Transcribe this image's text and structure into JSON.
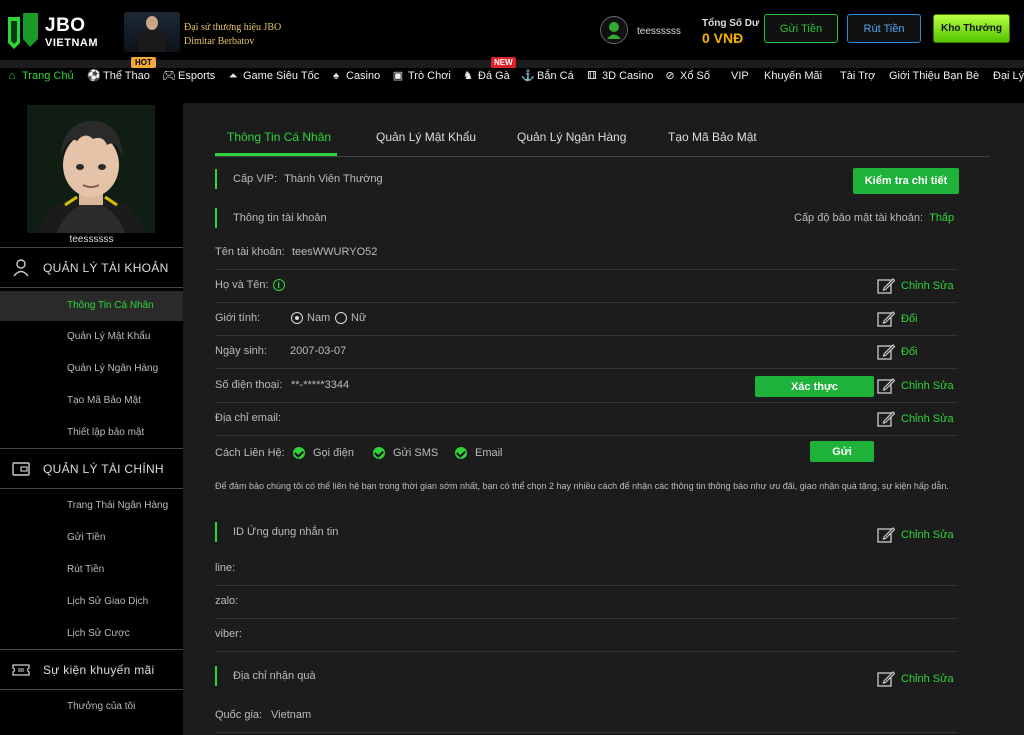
{
  "header": {
    "logo_main": "JBO",
    "logo_sub": "VIETNAM",
    "ambassador_line1": "Đại sứ thương hiệu JBO",
    "ambassador_line2": "Dimitar Berbatov",
    "hot_badge": "HOT",
    "username": "teessssss",
    "balance_label": "Tổng Số Dư",
    "balance_value": "0 VNĐ",
    "deposit_label": "Gửi Tiền",
    "withdraw_label": "Rút Tiền",
    "reward_label": "Kho Thưởng"
  },
  "nav": {
    "new_badge": "NEW",
    "items": [
      {
        "label": "Trang Chủ",
        "icon": "home-icon"
      },
      {
        "label": "Thể Thao",
        "icon": "soccer-ball-icon"
      },
      {
        "label": "Esports",
        "icon": "gamepad-icon"
      },
      {
        "label": "Game Siêu Tốc",
        "icon": "shoe-icon"
      },
      {
        "label": "Casino",
        "icon": "cards-icon"
      },
      {
        "label": "Trò Chơi",
        "icon": "slot-machine-icon"
      },
      {
        "label": "Đá Gà",
        "icon": "rooster-icon"
      },
      {
        "label": "Bắn Cá",
        "icon": "fish-icon"
      },
      {
        "label": "3D Casino",
        "icon": "dice-icon"
      },
      {
        "label": "Xổ Số",
        "icon": "lottery-ball-icon"
      },
      {
        "label": "VIP",
        "icon": ""
      },
      {
        "label": "Khuyến Mãi",
        "icon": ""
      },
      {
        "label": "Tài Trợ",
        "icon": ""
      },
      {
        "label": "Giới Thiệu Bạn Bè",
        "icon": ""
      },
      {
        "label": "Đại Lý",
        "icon": ""
      }
    ]
  },
  "sidebar": {
    "username": "teessssss",
    "section_account": "QUẢN LÝ TÀI KHOẢN",
    "account_items": [
      "Thông Tin Cá Nhân",
      "Quản Lý Mật Khẩu",
      "Quản Lý Ngân Hàng",
      "Tạo Mã Bảo Mật",
      "Thiết lập bảo mật"
    ],
    "section_finance": "QUẢN LÝ TÀI CHÍNH",
    "finance_items": [
      "Trang Thái Ngân Hàng",
      "Gửi Tiền",
      "Rút Tiền",
      "Lịch Sử Giao Dịch",
      "Lịch Sử Cược"
    ],
    "section_promo": "Sự kiện khuyến mãi",
    "promo_items": [
      "Thưởng của tôi"
    ]
  },
  "tabs": [
    "Thông Tin Cá Nhân",
    "Quản Lý Mật Khẩu",
    "Quản Lý Ngân Hàng",
    "Tạo Mã Bảo Mật"
  ],
  "profile": {
    "vip_label": "Cấp VIP:",
    "vip_value": "Thành Viên Thường",
    "vip_button": "Kiểm tra chi tiết",
    "account_info_title": "Thông tin tài khoản",
    "security_level_label": "Cấp độ bảo mật tài khoản:",
    "security_level_value": "Thấp",
    "account_name_label": "Tên tài khoản:",
    "account_name_value": "teesWWURYO52",
    "fullname_label": "Họ và Tên:",
    "gender_label": "Giới tính:",
    "gender_male": "Nam",
    "gender_female": "Nữ",
    "dob_label": "Ngày sinh:",
    "dob_value": "2007-03-07",
    "phone_label": "Số điện thoại:",
    "phone_value": "**-*****3344",
    "verify_button": "Xác thực",
    "email_label": "Địa chỉ email:",
    "contact_label": "Cách Liên Hệ:",
    "contact_call": "Gọi điện",
    "contact_sms": "Gửi SMS",
    "contact_email": "Email",
    "send_button": "Gửi",
    "note": "Để đảm bảo chúng tôi có thể liên hệ bạn trong thời gian sớm nhất, bạn có thể chọn 2 hay nhiều cách để nhận các thông tin thông báo như ưu đãi, giao nhận quà tặng, sự kiện hấp dẫn.",
    "app_id_title": "ID Ứng dụng nhắn tin",
    "line_label": "line:",
    "zalo_label": "zalo:",
    "viber_label": "viber:",
    "gift_address_title": "Địa chỉ nhận quà",
    "country_label": "Quốc gia:",
    "country_value": "Vietnam",
    "edit_label": "Chỉnh Sửa",
    "change_label": "Đổi"
  },
  "colors": {
    "accent": "#2fd43b",
    "button_green": "#1fb23a",
    "balance": "#f5b400",
    "withdraw_blue": "#4aa6f0"
  }
}
